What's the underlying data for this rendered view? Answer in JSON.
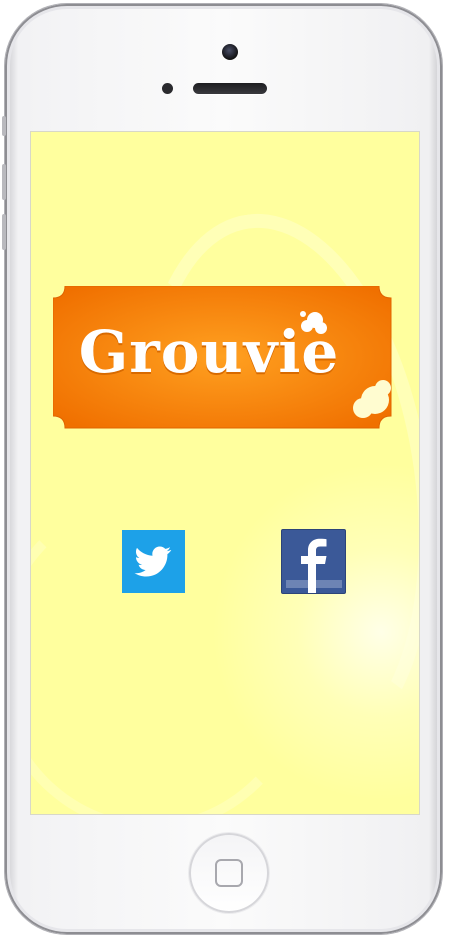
{
  "app": {
    "logo_text": "Grouvie"
  },
  "social": {
    "twitter_icon": "twitter-bird-icon",
    "facebook_icon": "facebook-f-icon"
  },
  "colors": {
    "screen_background": "#ffff9e",
    "logo_orange": "#ff8a00",
    "twitter_blue": "#1da1e8",
    "facebook_blue": "#3b5998"
  }
}
